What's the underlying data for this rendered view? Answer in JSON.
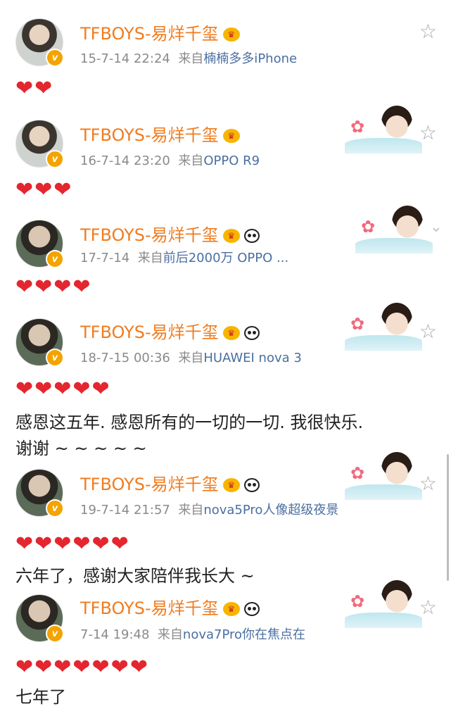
{
  "posts": [
    {
      "name": "TFBOYS-易烊千玺",
      "time": "15-7-14 22:24",
      "from": "来自",
      "source": "楠楠多多iPhone",
      "hearts": "❤❤",
      "text": []
    },
    {
      "name": "TFBOYS-易烊千玺",
      "time": "16-7-14 23:20",
      "from": "来自",
      "source": "OPPO R9",
      "hearts": "❤❤❤",
      "text": []
    },
    {
      "name": "TFBOYS-易烊千玺",
      "time": "17-7-14",
      "from": "来自",
      "source": "前后2000万 OPPO ...",
      "hearts": "❤❤❤❤",
      "text": []
    },
    {
      "name": "TFBOYS-易烊千玺",
      "time": "18-7-15 00:36",
      "from": "来自",
      "source": "HUAWEI nova 3",
      "hearts": "❤❤❤❤❤",
      "text": [
        "感恩这五年. 感恩所有的一切的一切. 我很快乐.",
        "谢谢 ~ ~ ~ ~ ~"
      ]
    },
    {
      "name": "TFBOYS-易烊千玺",
      "time": "19-7-14 21:57",
      "from": "来自",
      "source": "nova5Pro人像超级夜景",
      "hearts": "❤❤❤❤❤❤",
      "text": [
        "六年了，感谢大家陪伴我长大 ~"
      ]
    },
    {
      "name": "TFBOYS-易烊千玺",
      "time": "7-14 19:48",
      "from": "来自",
      "source": "nova7Pro你在焦点在",
      "hearts": "❤❤❤❤❤❤❤",
      "text": [
        "七年了"
      ]
    }
  ],
  "icons": {
    "star": "star-outline-icon",
    "crown": "crown-badge-icon",
    "panda": "panda-badge-icon",
    "verified": "verified-v-icon",
    "chevron": "chevron-down-icon"
  },
  "colors": {
    "name": "#f07c20",
    "source": "#4a6fa0",
    "heart": "#e3262f",
    "meta": "#8a8a8a"
  }
}
